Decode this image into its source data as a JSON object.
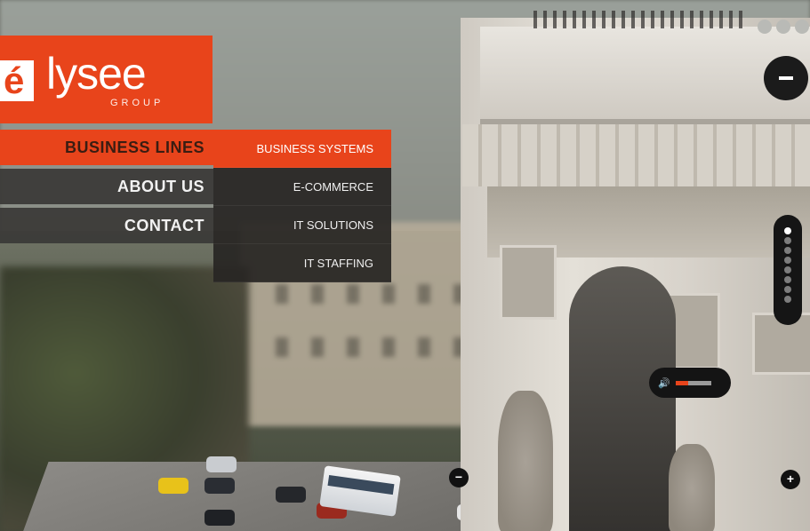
{
  "logo": {
    "mark_text": "é",
    "name": "lysee",
    "tagline": "GROUP",
    "brand_color": "#e8441b"
  },
  "nav": {
    "items": [
      {
        "label": "BUSINESS LINES",
        "active": true
      },
      {
        "label": "ABOUT US",
        "active": false
      },
      {
        "label": "CONTACT",
        "active": false
      }
    ]
  },
  "submenu": {
    "items": [
      {
        "label": "BUSINESS SYSTEMS",
        "active": true
      },
      {
        "label": "E-COMMERCE",
        "active": false
      },
      {
        "label": "IT SOLUTIONS",
        "active": false
      },
      {
        "label": "IT STAFFING",
        "active": false
      }
    ]
  },
  "controls": {
    "collapse_icon": "minus-icon",
    "slide_dots_count": 8,
    "active_slide_index": 0,
    "volume_icon": "speaker-icon",
    "volume_level": 0.35,
    "zoom_out_glyph": "−",
    "zoom_in_glyph": "+"
  }
}
